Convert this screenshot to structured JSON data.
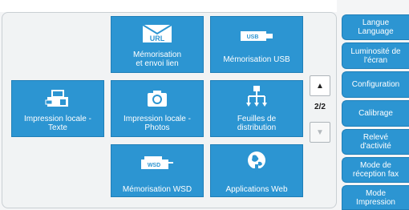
{
  "tiles": {
    "memo_envoi_lien": {
      "line1": "Mémorisation",
      "line2": "et envoi lien",
      "icon_label": "URL"
    },
    "memo_usb": {
      "line1": "Mémorisation USB",
      "icon_label": "USB"
    },
    "impression_texte": {
      "line1": "Impression locale -",
      "line2": "Texte"
    },
    "impression_photos": {
      "line1": "Impression locale -",
      "line2": "Photos"
    },
    "feuilles": {
      "line1": "Feuilles de",
      "line2": "distribution"
    },
    "memo_wsd": {
      "line1": "Mémorisation WSD",
      "icon_label": "WSD"
    },
    "apps_web": {
      "line1": "Applications Web"
    }
  },
  "pager": {
    "indicator": "2/2",
    "up": "▲",
    "down": "▼"
  },
  "sidebar": {
    "items": [
      {
        "l1": "Langue",
        "l2": "Language"
      },
      {
        "l1": "Luminosité de",
        "l2": "l'écran"
      },
      {
        "l1": "Configuration"
      },
      {
        "l1": "Calibrage"
      },
      {
        "l1": "Relevé",
        "l2": "d'activité"
      },
      {
        "l1": "Mode de",
        "l2": "réception fax"
      },
      {
        "l1": "Mode",
        "l2": "Impression"
      }
    ]
  },
  "colors": {
    "tile": "#2c95d2",
    "panel": "#f1f3f4",
    "text_on_tile": "#ffffff"
  }
}
